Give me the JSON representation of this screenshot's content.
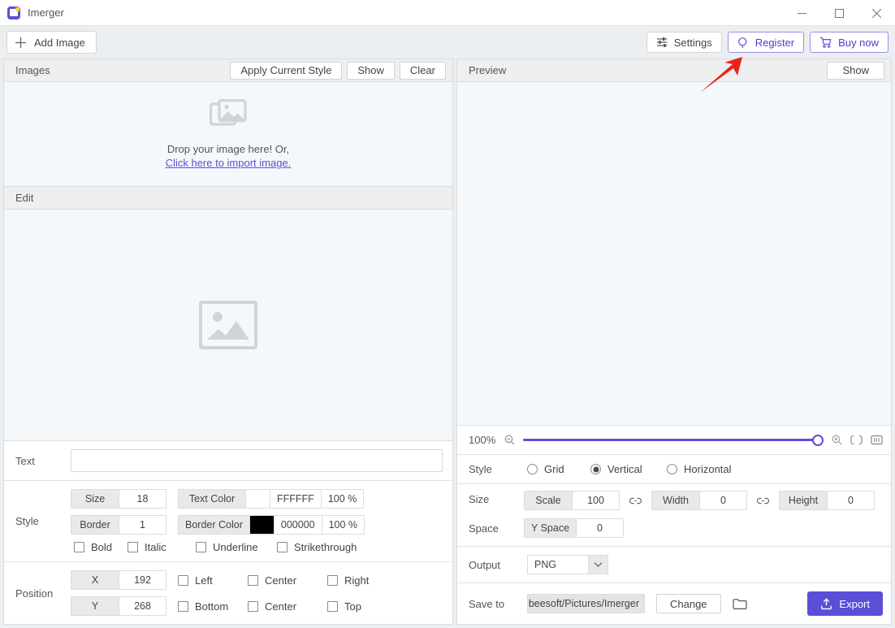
{
  "window": {
    "title": "Imerger",
    "app_icon": "app-logo-icon",
    "controls": {
      "minimize": "minimize-icon",
      "maximize": "maximize-icon",
      "close": "close-icon"
    }
  },
  "toolbar": {
    "add_image": "Add Image",
    "settings": "Settings",
    "register": "Register",
    "buy_now": "Buy now",
    "accent_color": "#5b4ed8"
  },
  "images_panel": {
    "title": "Images",
    "apply_current_style": "Apply Current Style",
    "show": "Show",
    "clear": "Clear",
    "drop_text": "Drop your image here! Or,",
    "drop_link": "Click here to import image."
  },
  "edit_panel": {
    "title": "Edit",
    "placeholder_icon": "image-placeholder-icon"
  },
  "text_row": {
    "label": "Text",
    "value": "",
    "placeholder": ""
  },
  "style_row": {
    "label": "Style",
    "size_label": "Size",
    "size_value": "18",
    "text_color_label": "Text Color",
    "text_color_value": "FFFFFF",
    "text_color_swatch": "#FFFFFF",
    "text_color_opacity": "100 %",
    "border_label": "Border",
    "border_value": "1",
    "border_color_label": "Border Color",
    "border_color_value": "000000",
    "border_color_swatch": "#000000",
    "border_color_opacity": "100 %",
    "checkboxes": [
      {
        "label": "Bold",
        "checked": false
      },
      {
        "label": "Italic",
        "checked": false
      },
      {
        "label": "Underline",
        "checked": false
      },
      {
        "label": "Strikethrough",
        "checked": false
      }
    ]
  },
  "position_row": {
    "label": "Position",
    "x_label": "X",
    "x_value": "192",
    "y_label": "Y",
    "y_value": "268",
    "align_top_row": [
      {
        "label": "Left",
        "checked": false
      },
      {
        "label": "Center",
        "checked": false
      },
      {
        "label": "Right",
        "checked": false
      }
    ],
    "align_bottom_row": [
      {
        "label": "Bottom",
        "checked": false
      },
      {
        "label": "Center",
        "checked": false
      },
      {
        "label": "Top",
        "checked": false
      }
    ]
  },
  "preview_panel": {
    "title": "Preview",
    "show": "Show"
  },
  "zoom_row": {
    "percent": "100%",
    "slider_value": 100,
    "zoom_out_icon": "zoom-out-icon",
    "zoom_in_icon": "zoom-in-icon",
    "fit_screen_icon": "fit-to-screen-icon",
    "actual_size_icon": "actual-size-icon",
    "track_color": "#5b4ed8"
  },
  "layout_style_row": {
    "label": "Style",
    "options": [
      {
        "label": "Grid",
        "selected": false
      },
      {
        "label": "Vertical",
        "selected": true
      },
      {
        "label": "Horizontal",
        "selected": false
      }
    ]
  },
  "size_row": {
    "label": "Size",
    "scale_label": "Scale",
    "scale_value": "100",
    "width_label": "Width",
    "width_value": "0",
    "height_label": "Height",
    "height_value": "0",
    "link_icon": "link-chain-icon"
  },
  "space_row": {
    "label": "Space",
    "y_space_label": "Y Space",
    "y_space_value": "0"
  },
  "output_row": {
    "label": "Output",
    "format": "PNG"
  },
  "save_row": {
    "label": "Save to",
    "path": "beesoft/Pictures/Imerger",
    "change": "Change",
    "folder_icon": "folder-icon",
    "export": "Export",
    "export_icon": "export-upload-icon"
  },
  "annotation": {
    "arrow": "red-arrow-pointing-to-register",
    "color": "#e8231a"
  }
}
